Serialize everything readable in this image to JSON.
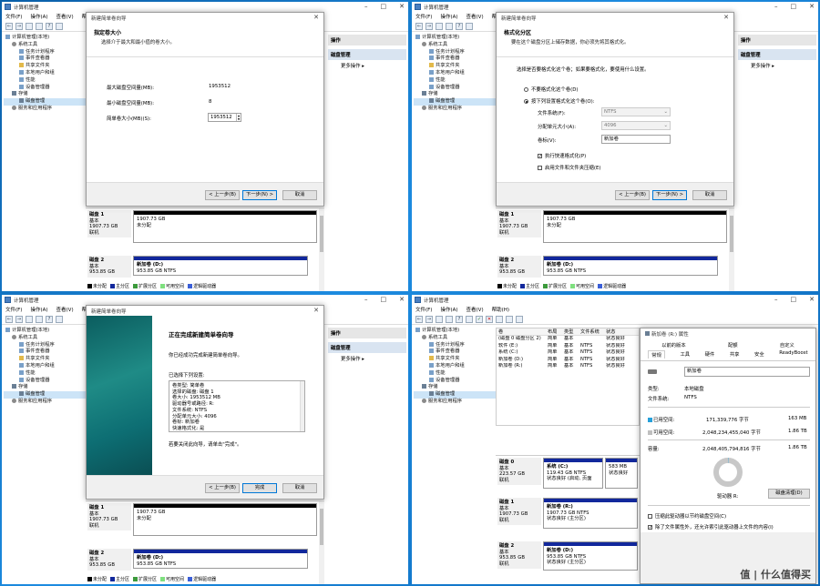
{
  "app": {
    "title": "计算机管理",
    "menu": [
      "文件(F)",
      "操作(A)",
      "查看(V)",
      "帮助(H)"
    ],
    "tree": [
      {
        "label": "计算机管理(本地)",
        "level": 0
      },
      {
        "label": "系统工具",
        "level": 1
      },
      {
        "label": "任务计划程序",
        "level": 2
      },
      {
        "label": "事件查看器",
        "level": 2
      },
      {
        "label": "共享文件夹",
        "level": 2
      },
      {
        "label": "本地用户和组",
        "level": 2
      },
      {
        "label": "性能",
        "level": 2
      },
      {
        "label": "设备管理器",
        "level": 2
      },
      {
        "label": "存储",
        "level": 1
      },
      {
        "label": "磁盘管理",
        "level": 2
      },
      {
        "label": "服务和应用程序",
        "level": 1
      }
    ],
    "actions": {
      "header": "操作",
      "selected": "磁盘管理",
      "more": "更多操作"
    },
    "disk1": {
      "name": "磁盘 1",
      "type": "基本",
      "size": "1907.73 GB",
      "status": "联机",
      "part_size": "1907.73 GB",
      "part_state": "未分配"
    },
    "disk2": {
      "name": "磁盘 2",
      "type": "基本",
      "size": "953.85 GB",
      "status": "联机",
      "vol_name": "新加卷 (D:)",
      "vol_info": "953.85 GB NTFS"
    },
    "legend": [
      "未分配",
      "主分区",
      "扩展分区",
      "可用空间",
      "逻辑驱动器"
    ]
  },
  "wizard": {
    "title": "新建简单卷向导",
    "back": "< 上一步(B)",
    "next": "下一步(N) >",
    "cancel": "取消",
    "finish": "完成",
    "step1": {
      "heading": "指定卷大小",
      "sub": "选择介于最大和最小值的卷大小。",
      "max_label": "最大磁盘空间量(MB):",
      "max_value": "1953512",
      "min_label": "最小磁盘空间量(MB):",
      "min_value": "8",
      "size_label": "简单卷大小(MB)(S):",
      "size_value": "1953512"
    },
    "step2": {
      "heading": "格式化分区",
      "sub": "要在这个磁盘分区上储存数据，你必须先将其格式化。",
      "prompt": "选择是否要格式化这个卷；如果要格式化，要使用什么设置。",
      "opt_no": "不要格式化这个卷(D)",
      "opt_yes": "按下列设置格式化这个卷(O):",
      "fs_label": "文件系统(F):",
      "fs_value": "NTFS",
      "au_label": "分配单元大小(A):",
      "au_value": "4096",
      "vl_label": "卷标(V):",
      "vl_value": "新加卷",
      "quick": "执行快速格式化(P)",
      "compress": "启用文件和文件夹压缩(E)"
    },
    "step3": {
      "heading": "正在完成新建简单卷向导",
      "line1": "你已经成功完成新建简单卷向导。",
      "line2": "已选择下列设置:",
      "settings": [
        "卷类型: 简单卷",
        "选择的磁盘: 磁盘 1",
        "卷大小: 1953512 MB",
        "驱动器号或路径: R:",
        "文件系统: NTFS",
        "分配单元大小: 4096",
        "卷标: 新加卷",
        "快速格式化: 是"
      ],
      "close_hint": "若要关闭此向导，请单击\"完成\"。"
    }
  },
  "q4": {
    "columns": [
      "卷",
      "布局",
      "类型",
      "文件系统",
      "状态"
    ],
    "rows": [
      {
        "vol": "(磁盘 0 磁盘分区 2)",
        "layout": "简单",
        "type": "基本",
        "fs": "",
        "status": "状态良好"
      },
      {
        "vol": "软件 (E:)",
        "layout": "简单",
        "type": "基本",
        "fs": "NTFS",
        "status": "状态良好"
      },
      {
        "vol": "系统 (C:)",
        "layout": "简单",
        "type": "基本",
        "fs": "NTFS",
        "status": "状态良好"
      },
      {
        "vol": "新加卷 (D:)",
        "layout": "简单",
        "type": "基本",
        "fs": "NTFS",
        "status": "状态良好"
      },
      {
        "vol": "新加卷 (R:)",
        "layout": "简单",
        "type": "基本",
        "fs": "NTFS",
        "status": "状态良好"
      }
    ],
    "disk0": {
      "name": "磁盘 0",
      "type": "基本",
      "size": "223.57 GB",
      "status": "联机",
      "c_name": "系统 (C:)",
      "c_info": "119.43 GB NTFS",
      "c_state": "状态良好 (启动, 页面",
      "p_size": "583 MB",
      "p_state": "状态良好"
    },
    "disk1": {
      "name": "磁盘 1",
      "type": "基本",
      "size": "1907.73 GB",
      "status": "联机",
      "vol": "新加卷 (R:)",
      "vol_info": "1907.73 GB NTFS",
      "vol_state": "状态良好 (主分区)"
    },
    "disk2": {
      "name": "磁盘 2",
      "type": "基本",
      "size": "953.85 GB",
      "status": "联机",
      "vol": "新加卷 (D:)",
      "vol_info": "953.85 GB NTFS",
      "vol_state": "状态良好 (主分区)"
    },
    "props": {
      "title": "新加卷 (R:) 属性",
      "tabs_row1": [
        "以前的版本",
        "配额",
        "自定义"
      ],
      "tabs_row2": [
        "常规",
        "工具",
        "硬件",
        "共享",
        "安全",
        "ReadyBoost"
      ],
      "name": "新加卷",
      "type_label": "类型:",
      "type_value": "本地磁盘",
      "fs_label": "文件系统:",
      "fs_value": "NTFS",
      "used_label": "已用空间:",
      "used_bytes": "171,339,776 字节",
      "used_h": "163 MB",
      "free_label": "可用空间:",
      "free_bytes": "2,048,234,455,040 字节",
      "free_h": "1.86 TB",
      "cap_label": "容量:",
      "cap_bytes": "2,048,405,794,816 字节",
      "cap_h": "1.86 TB",
      "used_fraction": 0.0001,
      "drive_label": "驱动器 R:",
      "cleanup": "磁盘清理(D)",
      "compress": "压缩此驱动器以节约磁盘空间(C)",
      "index": "除了文件属性外，还允许索引此驱动器上文件的内容(I)"
    },
    "watermark": "值 | 什么值得买"
  }
}
